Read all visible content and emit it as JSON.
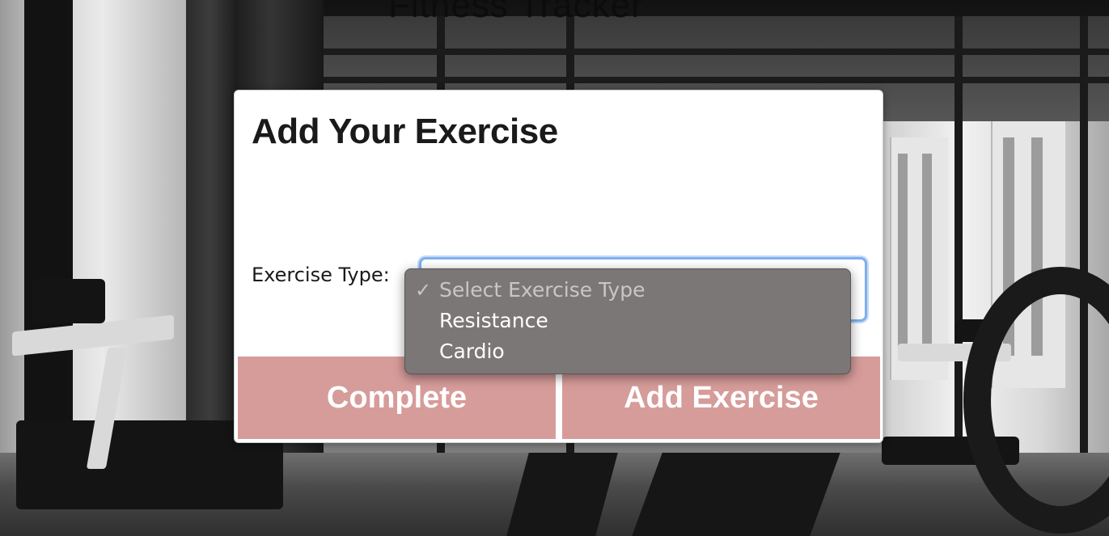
{
  "page": {
    "background_title": "Fitness Tracker"
  },
  "modal": {
    "title": "Add Your Exercise",
    "exercise_type_label": "Exercise Type:",
    "select": {
      "selected_value": "Select Exercise Type",
      "options": [
        {
          "label": "Select Exercise Type",
          "checked": true,
          "placeholder": true
        },
        {
          "label": "Resistance",
          "checked": false,
          "placeholder": false
        },
        {
          "label": "Cardio",
          "checked": false,
          "placeholder": false
        }
      ],
      "check_glyph": "✓"
    },
    "buttons": {
      "complete_label": "Complete",
      "add_exercise_label": "Add Exercise"
    }
  },
  "colors": {
    "button_bg": "#d69c9a",
    "button_text": "#ffffff",
    "focus_ring": "#7fb0ee",
    "dropdown_bg": "#7c7777"
  }
}
